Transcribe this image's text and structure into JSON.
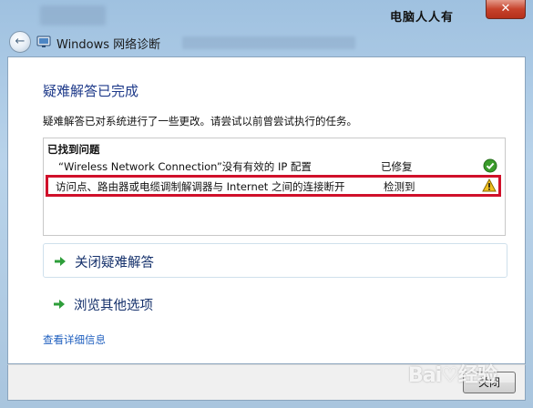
{
  "window": {
    "title": "Windows 网络诊断",
    "close_glyph": "✕",
    "watermark": "电脑人人有"
  },
  "main": {
    "heading": "疑难解答已完成",
    "description": "疑难解答已对系统进行了一些更改。请尝试以前曾尝试执行的任务。",
    "problems": {
      "header": "已找到问题",
      "rows": [
        {
          "text": "“Wireless Network Connection”没有有效的 IP 配置",
          "status": "已修复",
          "icon": "check-icon"
        },
        {
          "text": "访问点、路由器或电缆调制解调器与 Internet 之间的连接断开",
          "status": "检测到",
          "icon": "warning-icon"
        }
      ]
    },
    "commands": [
      {
        "label": "关闭疑难解答",
        "icon": "green-arrow-icon"
      },
      {
        "label": "浏览其他选项",
        "icon": "green-arrow-icon"
      }
    ],
    "details_link": "查看详细信息"
  },
  "footer": {
    "close_label": "关闭"
  },
  "colors": {
    "heading": "#1e3a8a",
    "highlight_border": "#d0102a",
    "link": "#1f5fbf",
    "success": "#3a9b2a",
    "warning": "#f0c020"
  }
}
